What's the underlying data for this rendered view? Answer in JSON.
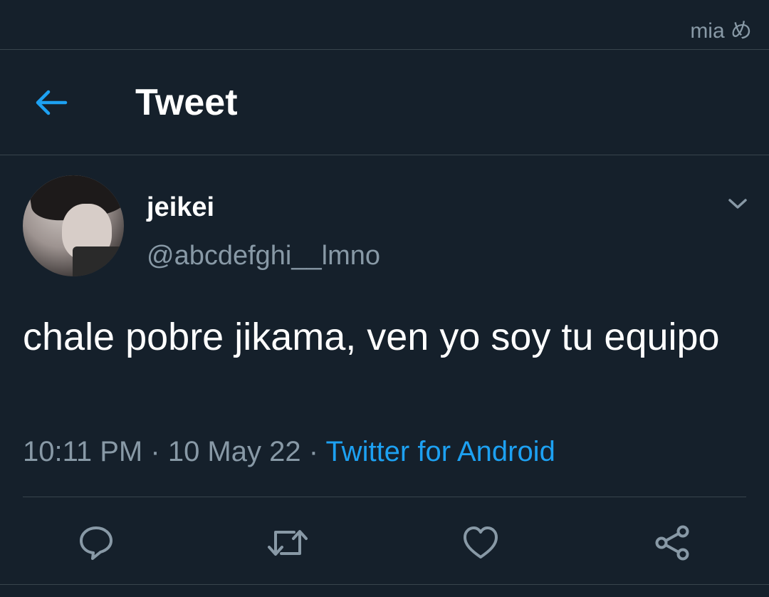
{
  "status_bar": {
    "text": "mia め"
  },
  "header": {
    "title": "Tweet",
    "back_icon": "arrow-left-icon"
  },
  "tweet": {
    "display_name": "jeikei",
    "handle": "@abcdefghi__lmno",
    "text": "chale pobre jikama, ven yo soy tu equipo",
    "time": "10:11 PM",
    "separator": "·",
    "date": "10 May 22",
    "source": "Twitter for Android",
    "more_icon": "chevron-down-icon"
  },
  "actions": [
    {
      "name": "reply",
      "icon": "comment-icon"
    },
    {
      "name": "retweet",
      "icon": "retweet-icon"
    },
    {
      "name": "like",
      "icon": "heart-icon"
    },
    {
      "name": "share",
      "icon": "share-icon"
    }
  ],
  "colors": {
    "background": "#15202b",
    "accent": "#1da1f2",
    "secondary_text": "#8899a6",
    "divider": "#38444d"
  }
}
